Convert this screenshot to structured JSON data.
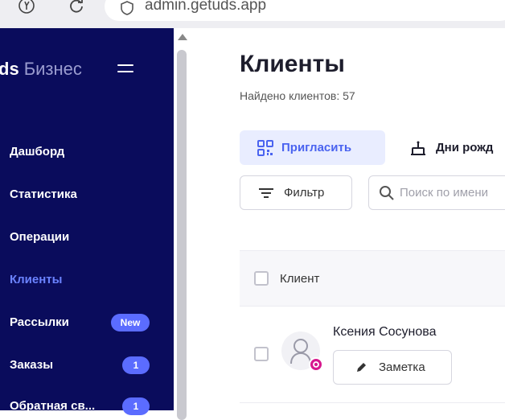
{
  "browser": {
    "url": "admin.getuds.app"
  },
  "sidebar": {
    "brand": "ds",
    "brand_sub": "Бизнес",
    "items": [
      {
        "label": "Дашборд"
      },
      {
        "label": "Статистика"
      },
      {
        "label": "Операции"
      },
      {
        "label": "Клиенты",
        "active": true
      },
      {
        "label": "Рассылки",
        "badge": "New"
      },
      {
        "label": "Заказы",
        "badge": "1"
      },
      {
        "label": "Обратная св...",
        "badge": "1"
      }
    ]
  },
  "main": {
    "title": "Клиенты",
    "count": "Найдено клиентов: 57",
    "invite_label": "Пригласить",
    "birthdays_label": "Дни рожд",
    "filter_label": "Фильтр",
    "search_placeholder": "Поиск по имени",
    "table": {
      "column_client": "Клиент",
      "rows": [
        {
          "name": "Ксения Сосунова",
          "note_label": "Заметка"
        }
      ]
    }
  },
  "colors": {
    "sidebar": "#0a0c5c",
    "accent": "#4a63f0",
    "badge": "#5b6cff",
    "avatar_badge": "#d7188e"
  }
}
